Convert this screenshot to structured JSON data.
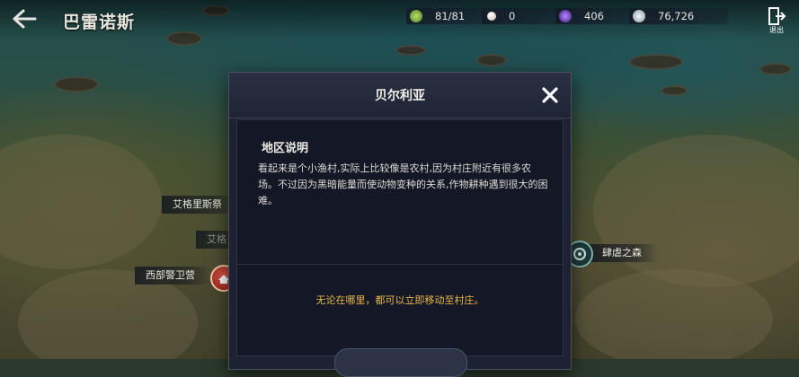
{
  "header": {
    "title": "巴雷诺斯",
    "back_icon": "back-arrow-icon",
    "exit_label": "退出",
    "exit_icon": "exit-door-icon"
  },
  "resources": [
    {
      "name": "stamina",
      "icon": "stamina-clover-icon",
      "color": "#7fbf3f",
      "value": "81/81"
    },
    {
      "name": "pearl",
      "icon": "pearl-icon",
      "color": "#e4d7d0",
      "value": "0"
    },
    {
      "name": "crystal",
      "icon": "purple-crystal-icon",
      "color": "#7a3fd1",
      "value": "406"
    },
    {
      "name": "silver",
      "icon": "silver-coin-icon",
      "color": "#c9d4dc",
      "value": "76,726"
    }
  ],
  "map": {
    "labels": {
      "west_guard_camp": "西部警卫营",
      "east_forest": "肆虐之森",
      "egg_1": "艾格里斯祭",
      "egg_2": "艾格"
    }
  },
  "modal": {
    "title": "贝尔利亚",
    "close_icon": "close-x-icon",
    "section_heading": "地区说明",
    "description": "看起来是个小渔村,实际上比较像是农村,因为村庄附近有很多农场。不过因为黑暗能量而使动物变种的关系,作物耕种遇到很大的困难。",
    "move_note": "无论在哪里，都可以立即移动至村庄。"
  },
  "colors": {
    "modal_bg": "#1d2233",
    "accent_gold": "#e9b84a"
  }
}
